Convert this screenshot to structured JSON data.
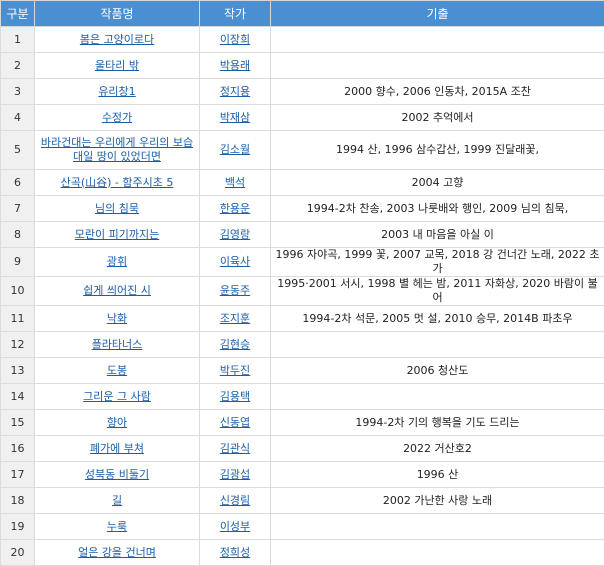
{
  "headers": {
    "num": "구분",
    "title": "작품명",
    "author": "작가",
    "exam": "기출"
  },
  "rows": [
    {
      "num": "1",
      "title": "봄은 고양이로다",
      "author": "이장희",
      "exam": ""
    },
    {
      "num": "2",
      "title": "울타리 밖",
      "author": "박용래",
      "exam": ""
    },
    {
      "num": "3",
      "title": "유리창1",
      "author": "정지용",
      "exam": "2000 향수, 2006 인동차, 2015A 조찬"
    },
    {
      "num": "4",
      "title": "수정가",
      "author": "박재삼",
      "exam": "2002 추억에서"
    },
    {
      "num": "5",
      "title": "바라건대는 우리에게 우리의 보습 대일 땅이 있었더면",
      "author": "김소월",
      "exam": "1994 산, 1996 삼수갑산, 1999 진달래꽃,"
    },
    {
      "num": "6",
      "title": "산곡(山谷) - 함주시초 5",
      "author": "백석",
      "exam": "2004 고향"
    },
    {
      "num": "7",
      "title": "님의 침묵",
      "author": "한용운",
      "exam": "1994-2차 찬송, 2003 나룻배와 행인, 2009 님의 침묵,"
    },
    {
      "num": "8",
      "title": "모란이 피기까지는",
      "author": "김영랑",
      "exam": "2003 내 마음을 아실 이"
    },
    {
      "num": "9",
      "title": "광휘",
      "author": "이육사",
      "exam": "1996 자야곡, 1999 꽃, 2007 교목, 2018 강 건너간 노래, 2022 초가"
    },
    {
      "num": "10",
      "title": "쉽게 씌어진 시",
      "author": "윤동주",
      "exam": "1995·2001 서시, 1998 별 헤는 밤, 2011 자화상, 2020 바람이 불어"
    },
    {
      "num": "11",
      "title": "낙화",
      "author": "조지훈",
      "exam": "1994-2차 석문, 2005 멋 설, 2010 승무, 2014B 파초우"
    },
    {
      "num": "12",
      "title": "플라타너스",
      "author": "김현승",
      "exam": ""
    },
    {
      "num": "13",
      "title": "도봉",
      "author": "박두진",
      "exam": "2006 청산도"
    },
    {
      "num": "14",
      "title": "그리운 그 사람",
      "author": "김용택",
      "exam": ""
    },
    {
      "num": "15",
      "title": "향아",
      "author": "신동엽",
      "exam": "1994-2차 기의 행복을 기도 드리는"
    },
    {
      "num": "16",
      "title": "폐가에 부쳐",
      "author": "김관식",
      "exam": "2022 거산호2"
    },
    {
      "num": "17",
      "title": "성북동 비둘기",
      "author": "김광섭",
      "exam": "1996 산"
    },
    {
      "num": "18",
      "title": "길",
      "author": "신경림",
      "exam": "2002 가난한 사랑 노래"
    },
    {
      "num": "19",
      "title": "누룩",
      "author": "이성부",
      "exam": ""
    },
    {
      "num": "20",
      "title": "얼은 강을 건너며",
      "author": "정희성",
      "exam": ""
    }
  ]
}
